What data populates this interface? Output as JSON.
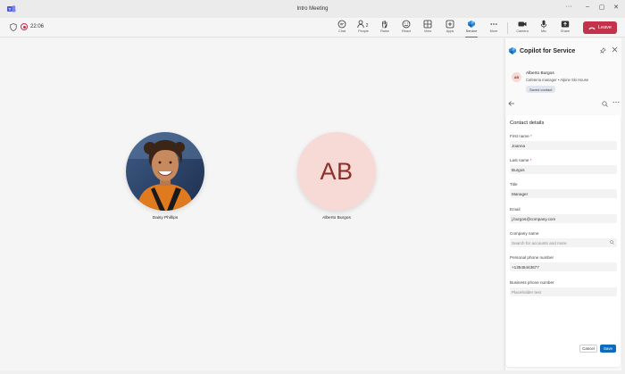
{
  "window": {
    "title": "Intro Meeting",
    "controls": {
      "more": "···",
      "minimize": "–",
      "maximize": "▢",
      "close": "✕"
    }
  },
  "toolbar": {
    "timer": "22:06",
    "buttons": [
      {
        "label": "Chat",
        "icon": "chat-icon"
      },
      {
        "label": "People",
        "icon": "people-icon",
        "count": "2"
      },
      {
        "label": "Raise",
        "icon": "raise-hand-icon"
      },
      {
        "label": "React",
        "icon": "react-icon"
      },
      {
        "label": "View",
        "icon": "view-icon"
      },
      {
        "label": "Apps",
        "icon": "apps-icon"
      },
      {
        "label": "Service",
        "icon": "service-icon",
        "active": true
      },
      {
        "label": "More",
        "icon": "more-icon"
      },
      {
        "label": "Camera",
        "icon": "camera-icon"
      },
      {
        "label": "Mic",
        "icon": "mic-icon"
      },
      {
        "label": "Share",
        "icon": "share-icon"
      }
    ],
    "leave_label": "Leave",
    "recording_color": "#c4314b",
    "leave_color": "#c4314b",
    "accent_color": "#5b5fc7"
  },
  "stage": {
    "participants": [
      {
        "name": "Daisy Phillips",
        "type": "photo"
      },
      {
        "name": "Alberto Burgos",
        "type": "initials",
        "initials": "AB"
      }
    ]
  },
  "panel": {
    "title": "Copilot for Service",
    "contact": {
      "initials": "AB",
      "name": "Alberto Burgos",
      "subtitle": "Cafeteria manager • Alpine Ski House",
      "badge": "Saved contact"
    },
    "form": {
      "title": "Contact details",
      "fields": [
        {
          "label": "First name",
          "required": true,
          "value": "Joanna"
        },
        {
          "label": "Last name",
          "required": true,
          "value": "Burgos"
        },
        {
          "label": "Title",
          "required": false,
          "value": "Manager"
        },
        {
          "label": "Email",
          "required": false,
          "value": "j.burgos@company.com"
        },
        {
          "label": "Company name",
          "required": false,
          "placeholder": "Search for accounts and more"
        },
        {
          "label": "Personal phone number",
          "required": false,
          "value": "+13545443677"
        },
        {
          "label": "Business phone number",
          "required": false,
          "placeholder": "Placeholder text"
        }
      ],
      "cancel_label": "Cancel",
      "save_label": "Save",
      "primary_color": "#0f6cbd"
    }
  }
}
